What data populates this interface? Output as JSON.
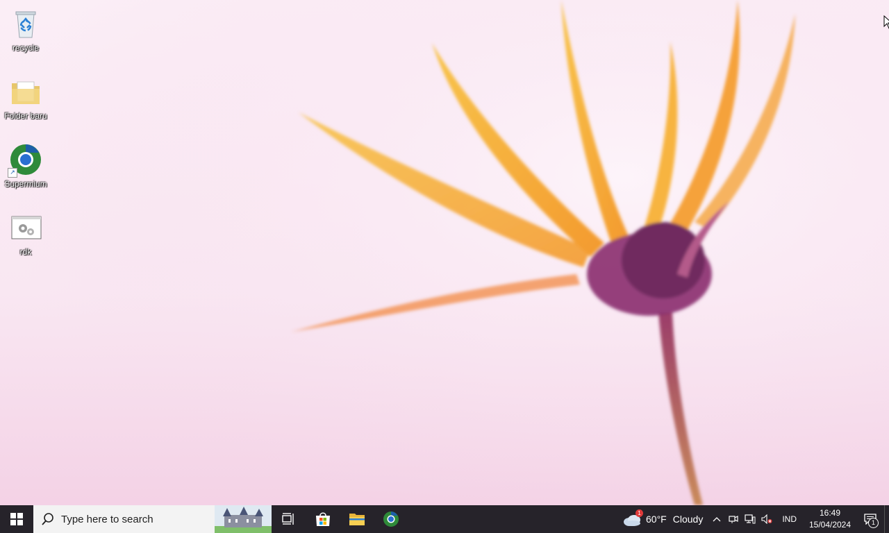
{
  "desktop": {
    "icons": [
      {
        "label": "recycle",
        "icon": "recycle-bin-icon"
      },
      {
        "label": "Folder baru",
        "icon": "folder-icon"
      },
      {
        "label": "Supermium",
        "icon": "supermium-browser-icon"
      },
      {
        "label": "rdk",
        "icon": "settings-app-icon"
      }
    ]
  },
  "taskbar": {
    "search_placeholder": "Type here to search",
    "pinned_apps": [
      "task-view-icon",
      "microsoft-store-icon",
      "file-explorer-icon",
      "supermium-icon"
    ],
    "weather": {
      "temp": "60°F",
      "condition": "Cloudy",
      "badge": "1"
    },
    "language": "IND",
    "time": "16:49",
    "date": "15/04/2024",
    "notification_count": "1"
  },
  "colors": {
    "taskbar": "#26232a",
    "accent_orange": "#f6a83a",
    "flower_purple": "#7b2a66"
  }
}
